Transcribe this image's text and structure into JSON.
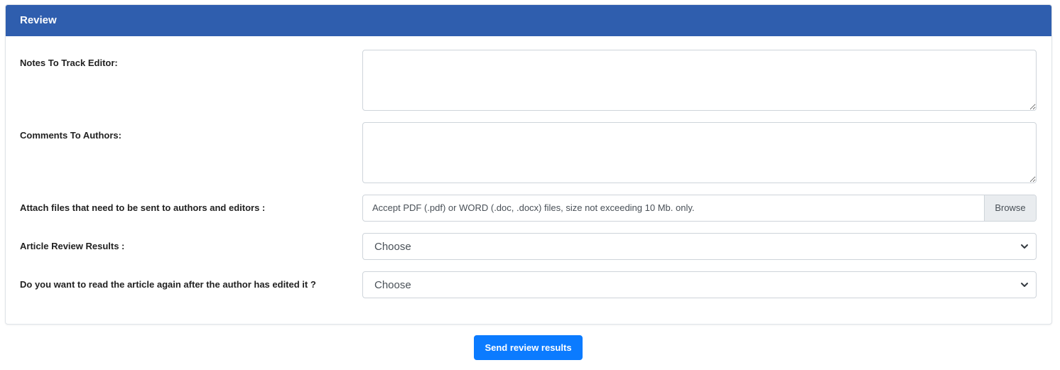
{
  "panel": {
    "title": "Review"
  },
  "form": {
    "notes_label": "Notes To Track Editor:",
    "notes_value": "",
    "comments_label": "Comments To Authors:",
    "comments_value": "",
    "attach_label": "Attach files that need to be sent to authors and editors :",
    "attach_placeholder": "Accept PDF (.pdf) or WORD (.doc, .docx) files, size not exceeding 10 Mb. only.",
    "browse_label": "Browse",
    "result_label": "Article Review Results :",
    "result_value": "Choose",
    "reread_label": "Do you want to read the article again after the author has edited it ?",
    "reread_value": "Choose"
  },
  "actions": {
    "send_label": "Send review results"
  },
  "icons": {
    "select_chevron": "chevron-down-icon",
    "resize_handle": "resize-handle-icon"
  },
  "colors": {
    "header_bg": "#2f5eae",
    "button_bg": "#0b7bff",
    "browse_bg": "#e9ecef"
  }
}
